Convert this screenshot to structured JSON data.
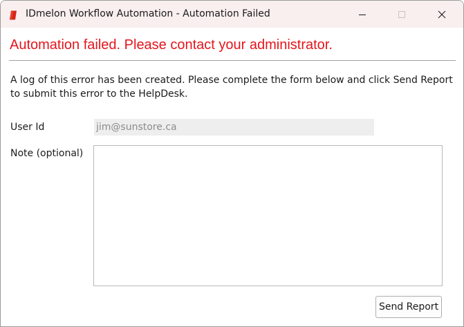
{
  "window": {
    "title": "IDmelon Workflow Automation - Automation Failed"
  },
  "icons": {
    "app": "idmelon-app-icon",
    "minimize": "minimize-icon",
    "maximize": "maximize-icon",
    "close": "close-icon"
  },
  "colors": {
    "error_text": "#e4151b",
    "titlebar_bg": "#f9efef",
    "app_icon": "#d62418"
  },
  "error": {
    "headline": "Automation failed. Please contact your administrator.",
    "description": "A log of this error has been created. Please complete the form below and click Send Report to submit this error to the HelpDesk."
  },
  "form": {
    "user_id_label": "User Id",
    "user_id_value": "jim@sunstore.ca",
    "note_label": "Note (optional)",
    "note_value": ""
  },
  "actions": {
    "send_report_label": "Send Report"
  }
}
